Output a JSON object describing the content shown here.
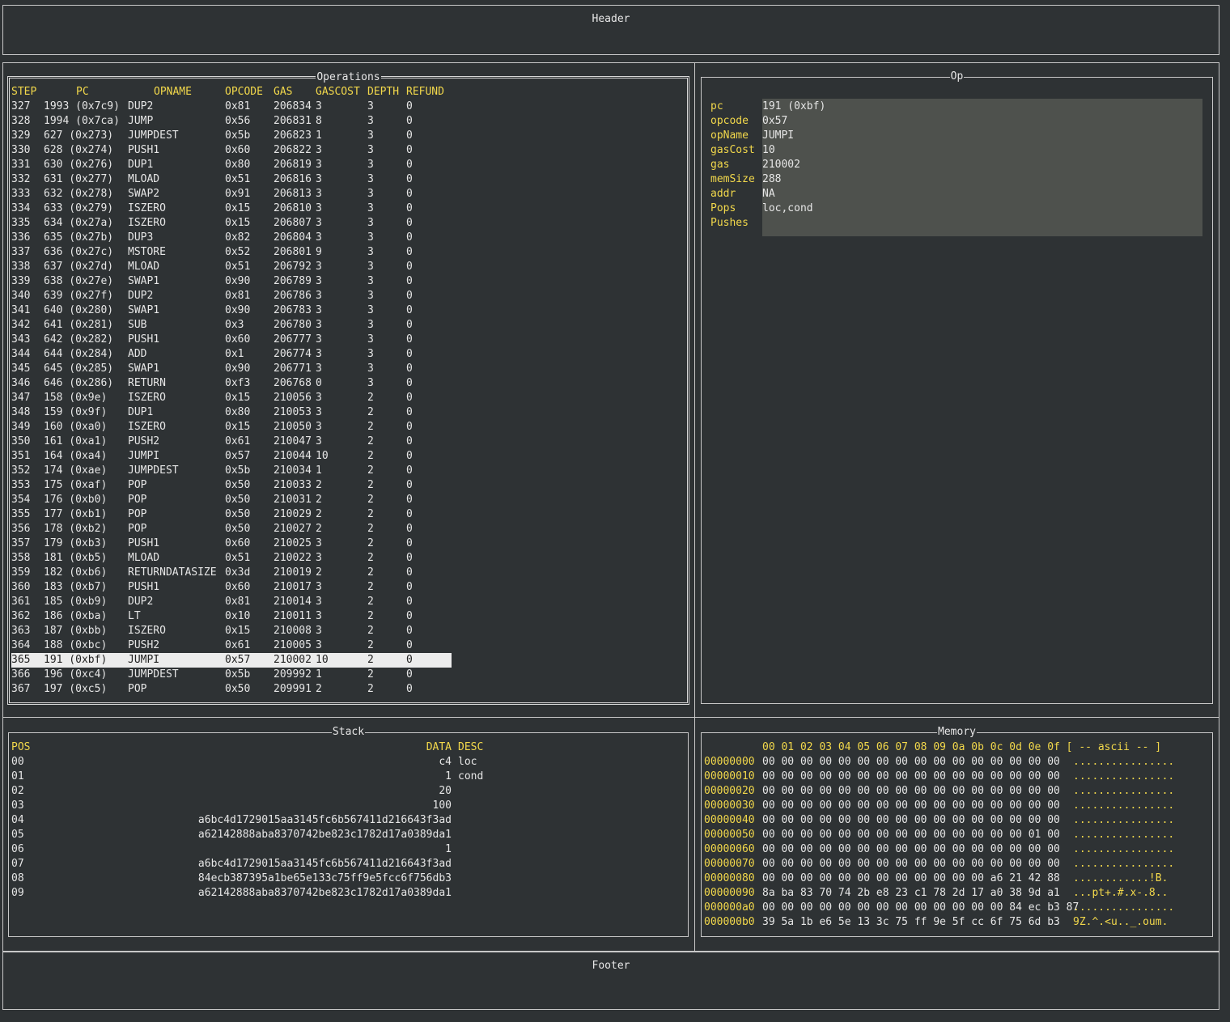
{
  "header": {
    "label": "Header"
  },
  "footer": {
    "label": "Footer"
  },
  "operations": {
    "title": "Operations",
    "columns": [
      "STEP",
      "PC",
      "OPNAME",
      "OPCODE",
      "GAS",
      "GASCOST",
      "DEPTH",
      "REFUND"
    ],
    "selected_step": "365",
    "rows": [
      [
        "327",
        "1993 (0x7c9)",
        "DUP2",
        "0x81",
        "206834",
        "3",
        "3",
        "0"
      ],
      [
        "328",
        "1994 (0x7ca)",
        "JUMP",
        "0x56",
        "206831",
        "8",
        "3",
        "0"
      ],
      [
        "329",
        "627 (0x273)",
        "JUMPDEST",
        "0x5b",
        "206823",
        "1",
        "3",
        "0"
      ],
      [
        "330",
        "628 (0x274)",
        "PUSH1",
        "0x60",
        "206822",
        "3",
        "3",
        "0"
      ],
      [
        "331",
        "630 (0x276)",
        "DUP1",
        "0x80",
        "206819",
        "3",
        "3",
        "0"
      ],
      [
        "332",
        "631 (0x277)",
        "MLOAD",
        "0x51",
        "206816",
        "3",
        "3",
        "0"
      ],
      [
        "333",
        "632 (0x278)",
        "SWAP2",
        "0x91",
        "206813",
        "3",
        "3",
        "0"
      ],
      [
        "334",
        "633 (0x279)",
        "ISZERO",
        "0x15",
        "206810",
        "3",
        "3",
        "0"
      ],
      [
        "335",
        "634 (0x27a)",
        "ISZERO",
        "0x15",
        "206807",
        "3",
        "3",
        "0"
      ],
      [
        "336",
        "635 (0x27b)",
        "DUP3",
        "0x82",
        "206804",
        "3",
        "3",
        "0"
      ],
      [
        "337",
        "636 (0x27c)",
        "MSTORE",
        "0x52",
        "206801",
        "9",
        "3",
        "0"
      ],
      [
        "338",
        "637 (0x27d)",
        "MLOAD",
        "0x51",
        "206792",
        "3",
        "3",
        "0"
      ],
      [
        "339",
        "638 (0x27e)",
        "SWAP1",
        "0x90",
        "206789",
        "3",
        "3",
        "0"
      ],
      [
        "340",
        "639 (0x27f)",
        "DUP2",
        "0x81",
        "206786",
        "3",
        "3",
        "0"
      ],
      [
        "341",
        "640 (0x280)",
        "SWAP1",
        "0x90",
        "206783",
        "3",
        "3",
        "0"
      ],
      [
        "342",
        "641 (0x281)",
        "SUB",
        "0x3",
        "206780",
        "3",
        "3",
        "0"
      ],
      [
        "343",
        "642 (0x282)",
        "PUSH1",
        "0x60",
        "206777",
        "3",
        "3",
        "0"
      ],
      [
        "344",
        "644 (0x284)",
        "ADD",
        "0x1",
        "206774",
        "3",
        "3",
        "0"
      ],
      [
        "345",
        "645 (0x285)",
        "SWAP1",
        "0x90",
        "206771",
        "3",
        "3",
        "0"
      ],
      [
        "346",
        "646 (0x286)",
        "RETURN",
        "0xf3",
        "206768",
        "0",
        "3",
        "0"
      ],
      [
        "347",
        "158 (0x9e)",
        "ISZERO",
        "0x15",
        "210056",
        "3",
        "2",
        "0"
      ],
      [
        "348",
        "159 (0x9f)",
        "DUP1",
        "0x80",
        "210053",
        "3",
        "2",
        "0"
      ],
      [
        "349",
        "160 (0xa0)",
        "ISZERO",
        "0x15",
        "210050",
        "3",
        "2",
        "0"
      ],
      [
        "350",
        "161 (0xa1)",
        "PUSH2",
        "0x61",
        "210047",
        "3",
        "2",
        "0"
      ],
      [
        "351",
        "164 (0xa4)",
        "JUMPI",
        "0x57",
        "210044",
        "10",
        "2",
        "0"
      ],
      [
        "352",
        "174 (0xae)",
        "JUMPDEST",
        "0x5b",
        "210034",
        "1",
        "2",
        "0"
      ],
      [
        "353",
        "175 (0xaf)",
        "POP",
        "0x50",
        "210033",
        "2",
        "2",
        "0"
      ],
      [
        "354",
        "176 (0xb0)",
        "POP",
        "0x50",
        "210031",
        "2",
        "2",
        "0"
      ],
      [
        "355",
        "177 (0xb1)",
        "POP",
        "0x50",
        "210029",
        "2",
        "2",
        "0"
      ],
      [
        "356",
        "178 (0xb2)",
        "POP",
        "0x50",
        "210027",
        "2",
        "2",
        "0"
      ],
      [
        "357",
        "179 (0xb3)",
        "PUSH1",
        "0x60",
        "210025",
        "3",
        "2",
        "0"
      ],
      [
        "358",
        "181 (0xb5)",
        "MLOAD",
        "0x51",
        "210022",
        "3",
        "2",
        "0"
      ],
      [
        "359",
        "182 (0xb6)",
        "RETURNDATASIZE",
        "0x3d",
        "210019",
        "2",
        "2",
        "0"
      ],
      [
        "360",
        "183 (0xb7)",
        "PUSH1",
        "0x60",
        "210017",
        "3",
        "2",
        "0"
      ],
      [
        "361",
        "185 (0xb9)",
        "DUP2",
        "0x81",
        "210014",
        "3",
        "2",
        "0"
      ],
      [
        "362",
        "186 (0xba)",
        "LT",
        "0x10",
        "210011",
        "3",
        "2",
        "0"
      ],
      [
        "363",
        "187 (0xbb)",
        "ISZERO",
        "0x15",
        "210008",
        "3",
        "2",
        "0"
      ],
      [
        "364",
        "188 (0xbc)",
        "PUSH2",
        "0x61",
        "210005",
        "3",
        "2",
        "0"
      ],
      [
        "365",
        "191 (0xbf)",
        "JUMPI",
        "0x57",
        "210002",
        "10",
        "2",
        "0"
      ],
      [
        "366",
        "196 (0xc4)",
        "JUMPDEST",
        "0x5b",
        "209992",
        "1",
        "2",
        "0"
      ],
      [
        "367",
        "197 (0xc5)",
        "POP",
        "0x50",
        "209991",
        "2",
        "2",
        "0"
      ]
    ]
  },
  "op": {
    "title": "Op",
    "fields": [
      {
        "key": "pc",
        "value": "191 (0xbf)"
      },
      {
        "key": "opcode",
        "value": "0x57"
      },
      {
        "key": "opName",
        "value": "JUMPI"
      },
      {
        "key": "gasCost",
        "value": "10"
      },
      {
        "key": "gas",
        "value": "210002"
      },
      {
        "key": "memSize",
        "value": "288"
      },
      {
        "key": "addr",
        "value": "NA"
      },
      {
        "key": "Pops",
        "value": "loc,cond"
      },
      {
        "key": "Pushes",
        "value": ""
      }
    ]
  },
  "stack": {
    "title": "Stack",
    "columns": [
      "POS",
      "DATA",
      "DESC"
    ],
    "rows": [
      [
        "00",
        "c4",
        "loc"
      ],
      [
        "01",
        "1",
        "cond"
      ],
      [
        "02",
        "20",
        ""
      ],
      [
        "03",
        "100",
        ""
      ],
      [
        "04",
        "a6bc4d1729015aa3145fc6b567411d216643f3ad",
        ""
      ],
      [
        "05",
        "a62142888aba8370742be823c1782d17a0389da1",
        ""
      ],
      [
        "06",
        "1",
        ""
      ],
      [
        "07",
        "a6bc4d1729015aa3145fc6b567411d216643f3ad",
        ""
      ],
      [
        "08",
        "84ecb387395a1be65e133c75ff9e5fcc6f756db3",
        ""
      ],
      [
        "09",
        "a62142888aba8370742be823c1782d17a0389da1",
        ""
      ]
    ]
  },
  "memory": {
    "title": "Memory",
    "header": "00 01 02 03 04 05 06 07 08 09 0a 0b 0c 0d 0e 0f [ -- ascii -- ]",
    "rows": [
      [
        "00000000",
        "00 00 00 00 00 00 00 00 00 00 00 00 00 00 00 00",
        "................"
      ],
      [
        "00000010",
        "00 00 00 00 00 00 00 00 00 00 00 00 00 00 00 00",
        "................"
      ],
      [
        "00000020",
        "00 00 00 00 00 00 00 00 00 00 00 00 00 00 00 00",
        "................"
      ],
      [
        "00000030",
        "00 00 00 00 00 00 00 00 00 00 00 00 00 00 00 00",
        "................"
      ],
      [
        "00000040",
        "00 00 00 00 00 00 00 00 00 00 00 00 00 00 00 00",
        "................"
      ],
      [
        "00000050",
        "00 00 00 00 00 00 00 00 00 00 00 00 00 00 01 00",
        "................"
      ],
      [
        "00000060",
        "00 00 00 00 00 00 00 00 00 00 00 00 00 00 00 00",
        "................"
      ],
      [
        "00000070",
        "00 00 00 00 00 00 00 00 00 00 00 00 00 00 00 00",
        "................"
      ],
      [
        "00000080",
        "00 00 00 00 00 00 00 00 00 00 00 00 a6 21 42 88",
        "............!B."
      ],
      [
        "00000090",
        "8a ba 83 70 74 2b e8 23 c1 78 2d 17 a0 38 9d a1",
        "...pt+.#.x-.8.."
      ],
      [
        "000000a0",
        "00 00 00 00 00 00 00 00 00 00 00 00 00 84 ec b3 87",
        "................"
      ],
      [
        "000000b0",
        "39 5a 1b e6 5e 13 3c 75 ff 9e 5f cc 6f 75 6d b3",
        "9Z.^.<u.._.oum."
      ]
    ]
  },
  "colors": {
    "background": "#2e3234",
    "accent": "#f2d84b",
    "highlight": "#ececec",
    "op_value_bg": "#4e514d"
  }
}
